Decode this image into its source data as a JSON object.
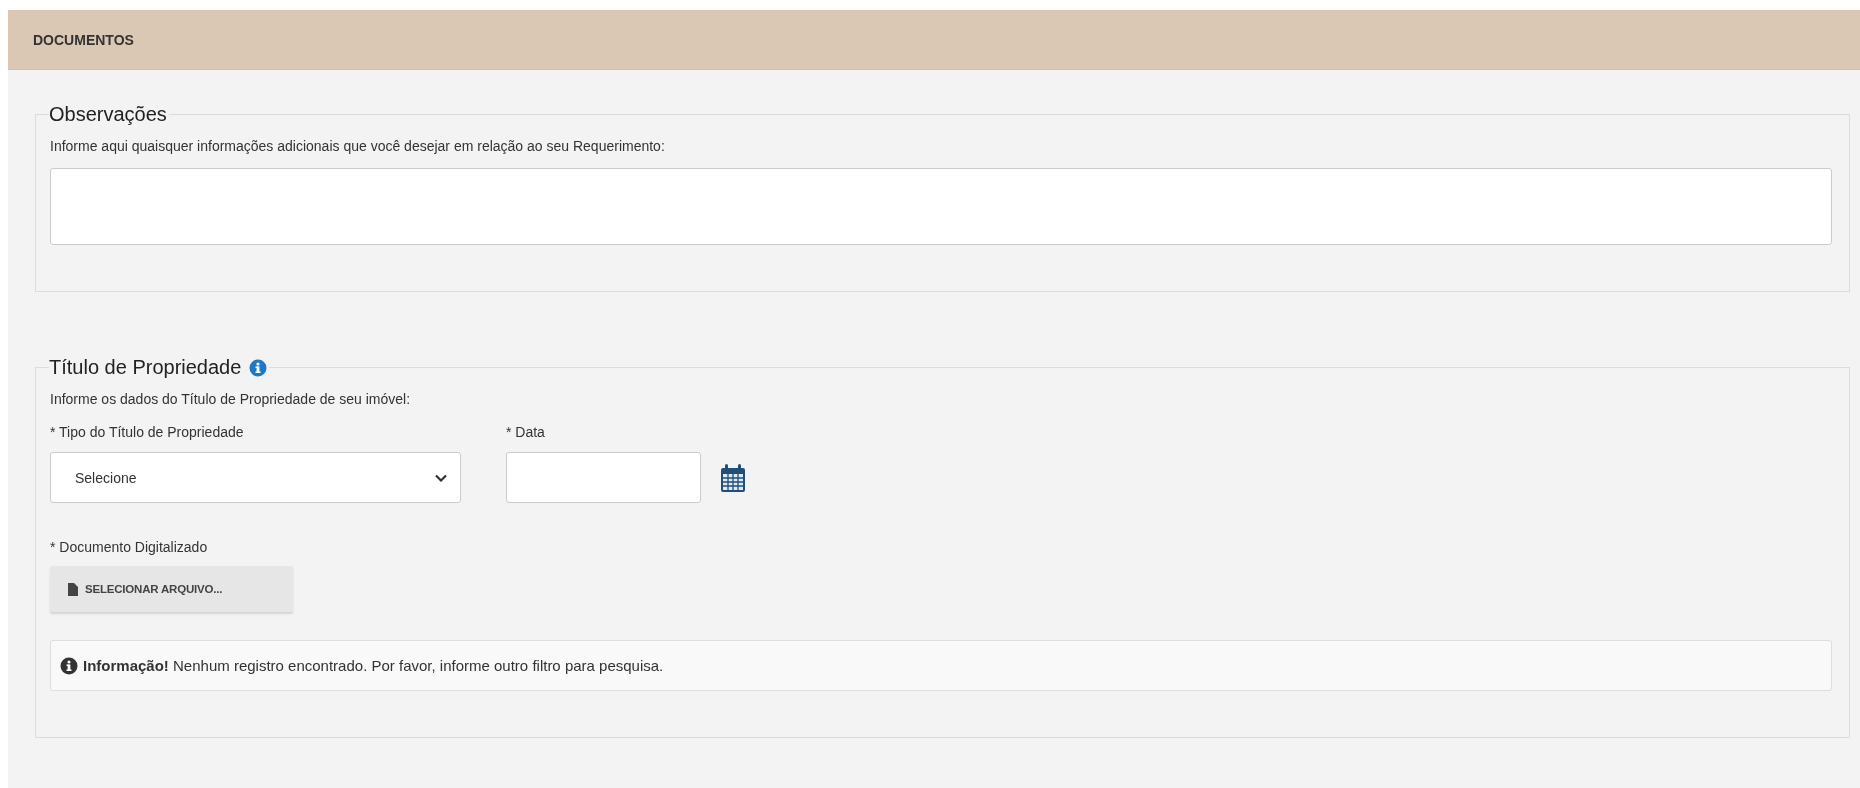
{
  "panel": {
    "title": "DOCUMENTOS"
  },
  "sections": [
    {
      "kind": "notes",
      "legend": "Observações",
      "info_icon": false,
      "hint": "Informe aqui quaisquer informações adicionais que você desejar em relação ao seu Requerimento:"
    },
    {
      "kind": "title_deed",
      "legend": "Título de Propriedade",
      "info_icon": true,
      "hint": "Informe os dados do Título de Propriedade de seu imóvel:",
      "type_label": "* Tipo do Título de Propriedade",
      "type_value": "Selecione",
      "date_label": "* Data",
      "file_label": "* Documento Digitalizado",
      "file_button": "SELECIONAR ARQUIVO...",
      "alert": "**Informação!** Nenhum registro encontrado. Por favor, informe outro filtro para pesquisa."
    }
  ]
}
